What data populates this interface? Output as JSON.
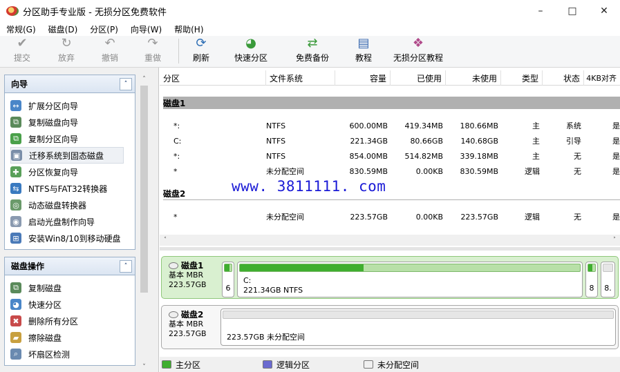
{
  "window": {
    "title": "分区助手专业版 - 无损分区免费软件"
  },
  "menu": [
    {
      "label": "常规(G)"
    },
    {
      "label": "磁盘(D)"
    },
    {
      "label": "分区(P)"
    },
    {
      "label": "向导(W)"
    },
    {
      "label": "帮助(H)"
    }
  ],
  "toolbar": {
    "commit": "提交",
    "discard": "放弃",
    "undo": "撤销",
    "redo": "重做",
    "refresh": "刷新",
    "quick_partition": "快速分区",
    "free_backup": "免费备份",
    "tutorial": "教程",
    "lossless_tutorial": "无损分区教程"
  },
  "wizard_panel": {
    "title": "向导",
    "items": [
      {
        "label": "扩展分区向导"
      },
      {
        "label": "复制磁盘向导"
      },
      {
        "label": "复制分区向导"
      },
      {
        "label": "迁移系统到固态磁盘"
      },
      {
        "label": "分区恢复向导"
      },
      {
        "label": "NTFS与FAT32转换器"
      },
      {
        "label": "动态磁盘转换器"
      },
      {
        "label": "启动光盘制作向导"
      },
      {
        "label": "安装Win8/10到移动硬盘"
      }
    ]
  },
  "disk_ops_panel": {
    "title": "磁盘操作",
    "items": [
      {
        "label": "复制磁盘"
      },
      {
        "label": "快速分区"
      },
      {
        "label": "删除所有分区"
      },
      {
        "label": "擦除磁盘"
      },
      {
        "label": "坏扇区检测"
      }
    ]
  },
  "table": {
    "headers": [
      "分区",
      "文件系统",
      "容量",
      "已使用",
      "未使用",
      "类型",
      "状态",
      "4KB对齐"
    ],
    "disk1_label": "磁盘1",
    "disk2_label": "磁盘2",
    "disk1_rows": [
      {
        "partition": "*:",
        "fs": "NTFS",
        "capacity": "600.00MB",
        "used": "419.34MB",
        "free": "180.66MB",
        "type": "主",
        "status": "系统",
        "align": "是"
      },
      {
        "partition": "C:",
        "fs": "NTFS",
        "capacity": "221.34GB",
        "used": "80.66GB",
        "free": "140.68GB",
        "type": "主",
        "status": "引导",
        "align": "是"
      },
      {
        "partition": "*:",
        "fs": "NTFS",
        "capacity": "854.00MB",
        "used": "514.82MB",
        "free": "339.18MB",
        "type": "主",
        "status": "无",
        "align": "是"
      },
      {
        "partition": "*",
        "fs": "未分配空间",
        "capacity": "830.59MB",
        "used": "0.00KB",
        "free": "830.59MB",
        "type": "逻辑",
        "status": "无",
        "align": "是"
      }
    ],
    "disk2_rows": [
      {
        "partition": "*",
        "fs": "未分配空间",
        "capacity": "223.57GB",
        "used": "0.00KB",
        "free": "223.57GB",
        "type": "逻辑",
        "status": "无",
        "align": "是"
      }
    ]
  },
  "watermark": "www. 3811111. com",
  "diskmap": {
    "disk1": {
      "name": "磁盘1",
      "kind": "基本 MBR",
      "size": "223.57GB",
      "p1_label": "6",
      "c_name": "C:",
      "c_detail": "221.34GB NTFS",
      "c_used_fraction": 0.364,
      "p3_label": "8",
      "p4_label": "8."
    },
    "disk2": {
      "name": "磁盘2",
      "kind": "基本 MBR",
      "size": "223.57GB",
      "unalloc_label": "223.57GB 未分配空间"
    }
  },
  "legend": {
    "primary": "主分区",
    "primary_color": "#3fae2f",
    "logical": "逻辑分区",
    "logical_color": "#6b6bd0",
    "unallocated": "未分配空间",
    "unallocated_color": "#f0f0f0"
  }
}
